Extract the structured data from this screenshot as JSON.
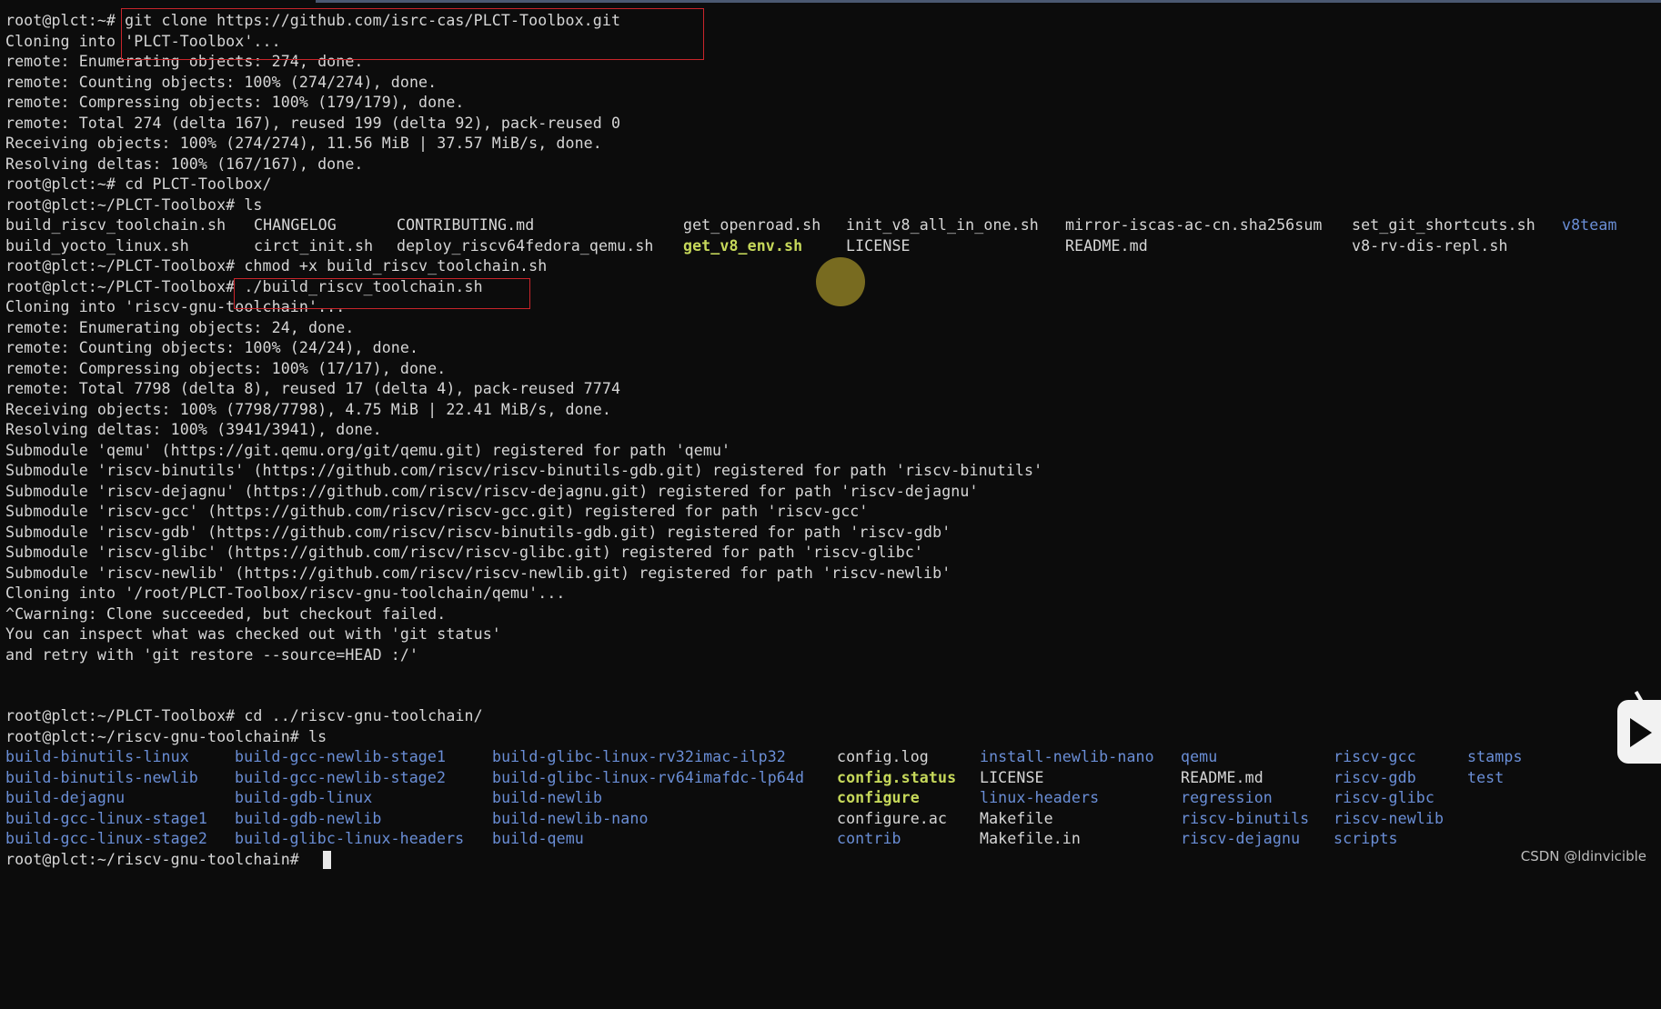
{
  "terminal": {
    "lines": [
      "root@plct:~# git clone https://github.com/isrc-cas/PLCT-Toolbox.git",
      "Cloning into 'PLCT-Toolbox'...",
      "remote: Enumerating objects: 274, done.",
      "remote: Counting objects: 100% (274/274), done.",
      "remote: Compressing objects: 100% (179/179), done.",
      "remote: Total 274 (delta 167), reused 199 (delta 92), pack-reused 0",
      "Receiving objects: 100% (274/274), 11.56 MiB | 37.57 MiB/s, done.",
      "Resolving deltas: 100% (167/167), done.",
      "root@plct:~# cd PLCT-Toolbox/",
      "root@plct:~/PLCT-Toolbox# ls",
      "root@plct:~/PLCT-Toolbox# chmod +x build_riscv_toolchain.sh",
      "root@plct:~/PLCT-Toolbox# ./build_riscv_toolchain.sh",
      "Cloning into 'riscv-gnu-toolchain'...",
      "remote: Enumerating objects: 24, done.",
      "remote: Counting objects: 100% (24/24), done.",
      "remote: Compressing objects: 100% (17/17), done.",
      "remote: Total 7798 (delta 8), reused 17 (delta 4), pack-reused 7774",
      "Receiving objects: 100% (7798/7798), 4.75 MiB | 22.41 MiB/s, done.",
      "Resolving deltas: 100% (3941/3941), done.",
      "Submodule 'qemu' (https://git.qemu.org/git/qemu.git) registered for path 'qemu'",
      "Submodule 'riscv-binutils' (https://github.com/riscv/riscv-binutils-gdb.git) registered for path 'riscv-binutils'",
      "Submodule 'riscv-dejagnu' (https://github.com/riscv/riscv-dejagnu.git) registered for path 'riscv-dejagnu'",
      "Submodule 'riscv-gcc' (https://github.com/riscv/riscv-gcc.git) registered for path 'riscv-gcc'",
      "Submodule 'riscv-gdb' (https://github.com/riscv/riscv-binutils-gdb.git) registered for path 'riscv-gdb'",
      "Submodule 'riscv-glibc' (https://github.com/riscv/riscv-glibc.git) registered for path 'riscv-glibc'",
      "Submodule 'riscv-newlib' (https://github.com/riscv/riscv-newlib.git) registered for path 'riscv-newlib'",
      "Cloning into '/root/PLCT-Toolbox/riscv-gnu-toolchain/qemu'...",
      "^Cwarning: Clone succeeded, but checkout failed.",
      "You can inspect what was checked out with 'git status'",
      "and retry with 'git restore --source=HEAD :/'",
      "",
      "",
      "root@plct:~/PLCT-Toolbox# cd ../riscv-gnu-toolchain/",
      "root@plct:~/riscv-gnu-toolchain# ls",
      "root@plct:~/riscv-gnu-toolchain# "
    ],
    "ls1": {
      "rows": [
        [
          {
            "text": "build_riscv_toolchain.sh",
            "c": ""
          },
          {
            "text": "CHANGELOG",
            "c": ""
          },
          {
            "text": "CONTRIBUTING.md",
            "c": ""
          },
          {
            "text": "get_openroad.sh",
            "c": ""
          },
          {
            "text": "init_v8_all_in_one.sh",
            "c": ""
          },
          {
            "text": "mirror-iscas-ac-cn.sha256sum",
            "c": ""
          },
          {
            "text": "set_git_shortcuts.sh",
            "c": ""
          },
          {
            "text": "v8team",
            "c": "blue"
          }
        ],
        [
          {
            "text": "build_yocto_linux.sh",
            "c": ""
          },
          {
            "text": "circt_init.sh",
            "c": ""
          },
          {
            "text": "deploy_riscv64fedora_qemu.sh",
            "c": ""
          },
          {
            "text": "get_v8_env.sh",
            "c": "green"
          },
          {
            "text": "LICENSE",
            "c": ""
          },
          {
            "text": "README.md",
            "c": ""
          },
          {
            "text": "v8-rv-dis-repl.sh",
            "c": ""
          }
        ]
      ]
    },
    "ls2": {
      "rows": [
        [
          {
            "text": "build-binutils-linux",
            "c": "blue"
          },
          {
            "text": "build-gcc-newlib-stage1",
            "c": "blue"
          },
          {
            "text": "build-glibc-linux-rv32imac-ilp32",
            "c": "blue"
          },
          {
            "text": "config.log",
            "c": ""
          },
          {
            "text": "install-newlib-nano",
            "c": "blue"
          },
          {
            "text": "qemu",
            "c": "blue"
          },
          {
            "text": "riscv-gcc",
            "c": "blue"
          },
          {
            "text": "stamps",
            "c": "blue"
          }
        ],
        [
          {
            "text": "build-binutils-newlib",
            "c": "blue"
          },
          {
            "text": "build-gcc-newlib-stage2",
            "c": "blue"
          },
          {
            "text": "build-glibc-linux-rv64imafdc-lp64d",
            "c": "blue"
          },
          {
            "text": "config.status",
            "c": "green"
          },
          {
            "text": "LICENSE",
            "c": ""
          },
          {
            "text": "README.md",
            "c": ""
          },
          {
            "text": "riscv-gdb",
            "c": "blue"
          },
          {
            "text": "test",
            "c": "blue"
          }
        ],
        [
          {
            "text": "build-dejagnu",
            "c": "blue"
          },
          {
            "text": "build-gdb-linux",
            "c": "blue"
          },
          {
            "text": "build-newlib",
            "c": "blue"
          },
          {
            "text": "configure",
            "c": "green"
          },
          {
            "text": "linux-headers",
            "c": "blue"
          },
          {
            "text": "regression",
            "c": "blue"
          },
          {
            "text": "riscv-glibc",
            "c": "blue"
          }
        ],
        [
          {
            "text": "build-gcc-linux-stage1",
            "c": "blue"
          },
          {
            "text": "build-gdb-newlib",
            "c": "blue"
          },
          {
            "text": "build-newlib-nano",
            "c": "blue"
          },
          {
            "text": "configure.ac",
            "c": ""
          },
          {
            "text": "Makefile",
            "c": ""
          },
          {
            "text": "riscv-binutils",
            "c": "blue"
          },
          {
            "text": "riscv-newlib",
            "c": "blue"
          }
        ],
        [
          {
            "text": "build-gcc-linux-stage2",
            "c": "blue"
          },
          {
            "text": "build-glibc-linux-headers",
            "c": "blue"
          },
          {
            "text": "build-qemu",
            "c": "blue"
          },
          {
            "text": "contrib",
            "c": "blue"
          },
          {
            "text": "Makefile.in",
            "c": ""
          },
          {
            "text": "riscv-dejagnu",
            "c": "blue"
          },
          {
            "text": "scripts",
            "c": "blue"
          }
        ]
      ]
    }
  },
  "watermark": "CSDN @ldinvicible",
  "colors": {
    "background": "#0c0c0c",
    "text": "#d6d6d6",
    "directory": "#6a8ed6",
    "executable": "#c6d85a",
    "highlight_box": "#c9252b"
  }
}
